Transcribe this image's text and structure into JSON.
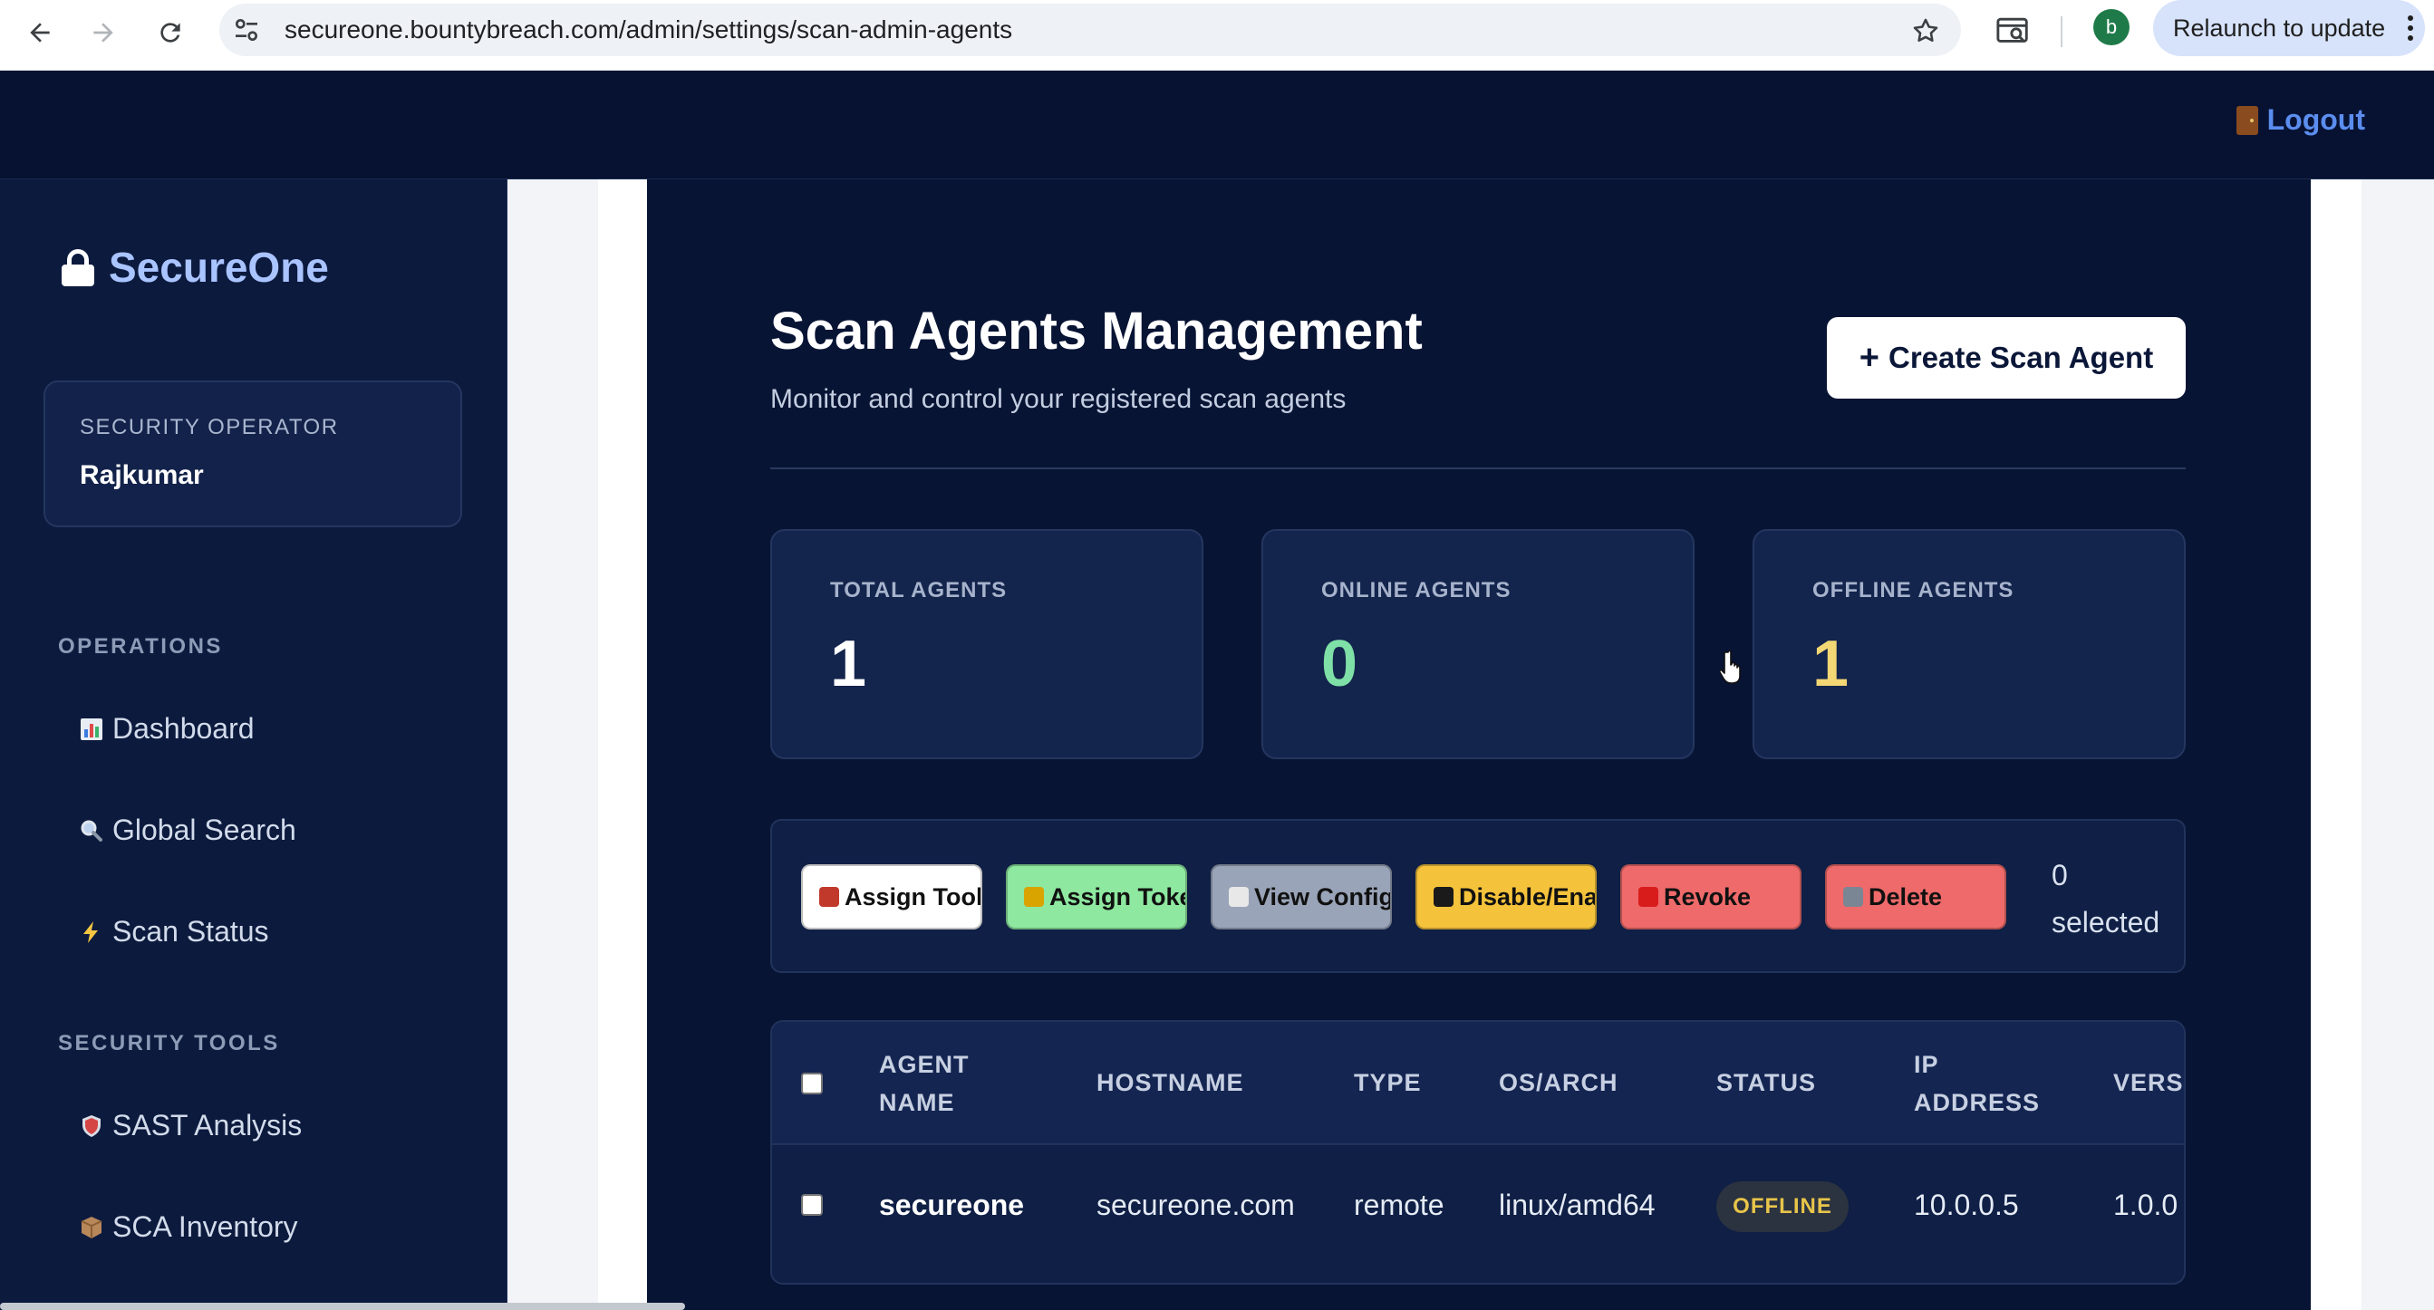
{
  "browser": {
    "url": "secureone.bountybreach.com/admin/settings/scan-admin-agents",
    "profile_initial": "b",
    "relaunch_label": "Relaunch to update"
  },
  "topbar": {
    "logout_label": "Logout"
  },
  "sidebar": {
    "brand": "SecureOne",
    "operator_role": "SECURITY OPERATOR",
    "operator_name": "Rajkumar",
    "sections": [
      {
        "label": "OPERATIONS",
        "items": [
          {
            "label": "Dashboard",
            "icon": "bar-chart-icon"
          },
          {
            "label": "Global Search",
            "icon": "magnifier-icon"
          },
          {
            "label": "Scan Status",
            "icon": "lightning-icon"
          }
        ]
      },
      {
        "label": "SECURITY TOOLS",
        "items": [
          {
            "label": "SAST Analysis",
            "icon": "shield-icon"
          },
          {
            "label": "SCA Inventory",
            "icon": "package-icon"
          }
        ]
      }
    ]
  },
  "main": {
    "title": "Scan Agents Management",
    "subtitle": "Monitor and control your registered scan agents",
    "create_button": "Create Scan Agent",
    "stats": [
      {
        "label": "TOTAL AGENTS",
        "value": "1",
        "color": "#ffffff"
      },
      {
        "label": "ONLINE AGENTS",
        "value": "0",
        "color": "#7ee0a6"
      },
      {
        "label": "OFFLINE AGENTS",
        "value": "1",
        "color": "#f3d774"
      }
    ],
    "actions": [
      {
        "label": "Assign Tools",
        "bg": "#ffffff",
        "icon_color": "#c0392b"
      },
      {
        "label": "Assign Tokens",
        "bg": "#8ee8a0",
        "icon_color": "#d9a300"
      },
      {
        "label": "View Config",
        "bg": "#9aa4b8",
        "icon_color": "#e8e8e8"
      },
      {
        "label": "Disable/Enable",
        "bg": "#f5c33b",
        "icon_color": "#1a1a1a"
      },
      {
        "label": "Revoke",
        "bg": "#ef6a6a",
        "icon_color": "#d81c1c"
      },
      {
        "label": "Delete",
        "bg": "#ef6a6a",
        "icon_color": "#7b8694"
      }
    ],
    "selected_count": "0",
    "selected_label": "selected",
    "table": {
      "columns": [
        "AGENT NAME",
        "HOSTNAME",
        "TYPE",
        "OS/ARCH",
        "STATUS",
        "IP ADDRESS",
        "VERSION"
      ],
      "rows": [
        {
          "agent_name": "secureone",
          "hostname": "secureone.com",
          "type": "remote",
          "os_arch": "linux/amd64",
          "status": "OFFLINE",
          "ip_address": "10.0.0.5",
          "version": "1.0.0"
        }
      ]
    }
  }
}
